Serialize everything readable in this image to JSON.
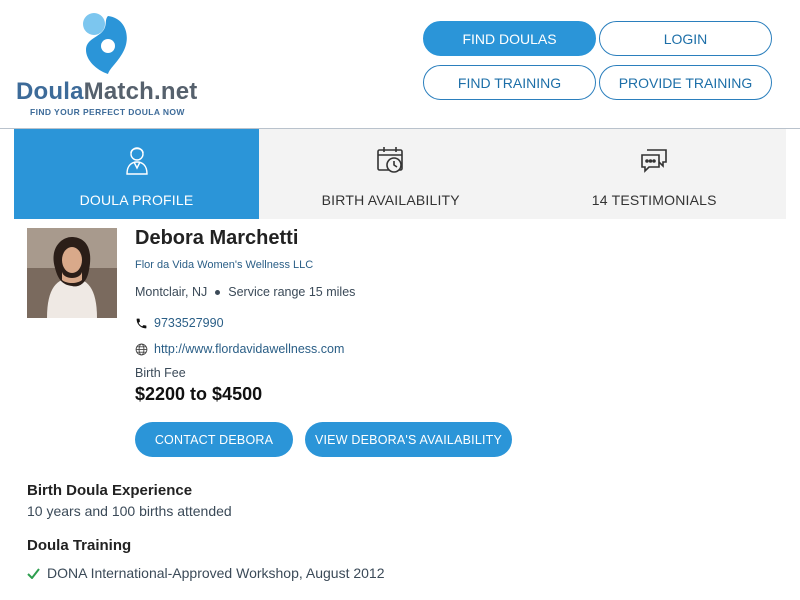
{
  "logo": {
    "name_part1": "Doula",
    "name_part2": "Match.net",
    "tagline": "FIND YOUR PERFECT DOULA NOW"
  },
  "nav": {
    "find_doulas": "FIND DOULAS",
    "login": "LOGIN",
    "find_training": "FIND TRAINING",
    "provide_training": "PROVIDE TRAINING"
  },
  "tabs": [
    {
      "label": "DOULA PROFILE",
      "icon": "doula-person-icon",
      "active": true
    },
    {
      "label": "BIRTH AVAILABILITY",
      "icon": "calendar-clock-icon",
      "active": false
    },
    {
      "label": "14 TESTIMONIALS",
      "icon": "chat-bubbles-icon",
      "active": false
    }
  ],
  "profile": {
    "name": "Debora Marchetti",
    "company": "Flor da Vida Women's Wellness LLC",
    "location": "Montclair, NJ",
    "service_range": "Service range 15 miles",
    "phone": "9733527990",
    "website": "http://www.flordavidawellness.com",
    "fee_label": "Birth Fee",
    "fee": "$2200 to $4500"
  },
  "actions": {
    "contact": "CONTACT DEBORA",
    "availability": "VIEW DEBORA'S AVAILABILITY"
  },
  "experience": {
    "title": "Birth Doula Experience",
    "text": "10 years and 100 births attended"
  },
  "training": {
    "title": "Doula Training",
    "items": [
      "DONA International-Approved Workshop, August 2012"
    ]
  },
  "colors": {
    "primary": "#2b95d8",
    "logo_blue": "#3d6b99",
    "check_green": "#2e9e4f"
  }
}
